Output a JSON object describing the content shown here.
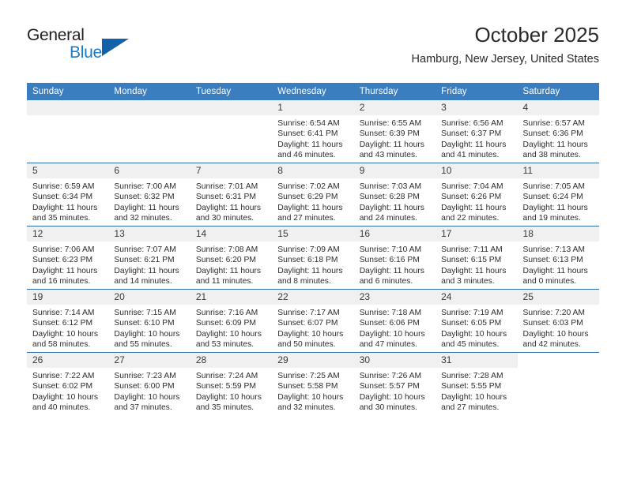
{
  "brand": {
    "word_one": "General",
    "word_two": "Blue",
    "triangle_color": "#1361a8",
    "blue_color": "#1b7bc4"
  },
  "header": {
    "title": "October 2025",
    "location": "Hamburg, New Jersey, United States"
  },
  "theme": {
    "header_bg": "#3a7ebf",
    "row_rule": "#2f6ea5",
    "daynum_bg": "#f0f0f0",
    "text": "#2d2d2d"
  },
  "weekday_headers": [
    "Sunday",
    "Monday",
    "Tuesday",
    "Wednesday",
    "Thursday",
    "Friday",
    "Saturday"
  ],
  "weeks": [
    [
      {
        "day": "",
        "sunrise": "",
        "sunset": "",
        "daylight_a": "",
        "daylight_b": "",
        "state": "empty"
      },
      {
        "day": "",
        "sunrise": "",
        "sunset": "",
        "daylight_a": "",
        "daylight_b": "",
        "state": "empty"
      },
      {
        "day": "",
        "sunrise": "",
        "sunset": "",
        "daylight_a": "",
        "daylight_b": "",
        "state": "empty"
      },
      {
        "day": "1",
        "sunrise": "Sunrise: 6:54 AM",
        "sunset": "Sunset: 6:41 PM",
        "daylight_a": "Daylight: 11 hours",
        "daylight_b": "and 46 minutes.",
        "state": "day"
      },
      {
        "day": "2",
        "sunrise": "Sunrise: 6:55 AM",
        "sunset": "Sunset: 6:39 PM",
        "daylight_a": "Daylight: 11 hours",
        "daylight_b": "and 43 minutes.",
        "state": "day"
      },
      {
        "day": "3",
        "sunrise": "Sunrise: 6:56 AM",
        "sunset": "Sunset: 6:37 PM",
        "daylight_a": "Daylight: 11 hours",
        "daylight_b": "and 41 minutes.",
        "state": "day"
      },
      {
        "day": "4",
        "sunrise": "Sunrise: 6:57 AM",
        "sunset": "Sunset: 6:36 PM",
        "daylight_a": "Daylight: 11 hours",
        "daylight_b": "and 38 minutes.",
        "state": "day"
      }
    ],
    [
      {
        "day": "5",
        "sunrise": "Sunrise: 6:59 AM",
        "sunset": "Sunset: 6:34 PM",
        "daylight_a": "Daylight: 11 hours",
        "daylight_b": "and 35 minutes.",
        "state": "day"
      },
      {
        "day": "6",
        "sunrise": "Sunrise: 7:00 AM",
        "sunset": "Sunset: 6:32 PM",
        "daylight_a": "Daylight: 11 hours",
        "daylight_b": "and 32 minutes.",
        "state": "day"
      },
      {
        "day": "7",
        "sunrise": "Sunrise: 7:01 AM",
        "sunset": "Sunset: 6:31 PM",
        "daylight_a": "Daylight: 11 hours",
        "daylight_b": "and 30 minutes.",
        "state": "day"
      },
      {
        "day": "8",
        "sunrise": "Sunrise: 7:02 AM",
        "sunset": "Sunset: 6:29 PM",
        "daylight_a": "Daylight: 11 hours",
        "daylight_b": "and 27 minutes.",
        "state": "day"
      },
      {
        "day": "9",
        "sunrise": "Sunrise: 7:03 AM",
        "sunset": "Sunset: 6:28 PM",
        "daylight_a": "Daylight: 11 hours",
        "daylight_b": "and 24 minutes.",
        "state": "day"
      },
      {
        "day": "10",
        "sunrise": "Sunrise: 7:04 AM",
        "sunset": "Sunset: 6:26 PM",
        "daylight_a": "Daylight: 11 hours",
        "daylight_b": "and 22 minutes.",
        "state": "day"
      },
      {
        "day": "11",
        "sunrise": "Sunrise: 7:05 AM",
        "sunset": "Sunset: 6:24 PM",
        "daylight_a": "Daylight: 11 hours",
        "daylight_b": "and 19 minutes.",
        "state": "day"
      }
    ],
    [
      {
        "day": "12",
        "sunrise": "Sunrise: 7:06 AM",
        "sunset": "Sunset: 6:23 PM",
        "daylight_a": "Daylight: 11 hours",
        "daylight_b": "and 16 minutes.",
        "state": "day"
      },
      {
        "day": "13",
        "sunrise": "Sunrise: 7:07 AM",
        "sunset": "Sunset: 6:21 PM",
        "daylight_a": "Daylight: 11 hours",
        "daylight_b": "and 14 minutes.",
        "state": "day"
      },
      {
        "day": "14",
        "sunrise": "Sunrise: 7:08 AM",
        "sunset": "Sunset: 6:20 PM",
        "daylight_a": "Daylight: 11 hours",
        "daylight_b": "and 11 minutes.",
        "state": "day"
      },
      {
        "day": "15",
        "sunrise": "Sunrise: 7:09 AM",
        "sunset": "Sunset: 6:18 PM",
        "daylight_a": "Daylight: 11 hours",
        "daylight_b": "and 8 minutes.",
        "state": "day"
      },
      {
        "day": "16",
        "sunrise": "Sunrise: 7:10 AM",
        "sunset": "Sunset: 6:16 PM",
        "daylight_a": "Daylight: 11 hours",
        "daylight_b": "and 6 minutes.",
        "state": "day"
      },
      {
        "day": "17",
        "sunrise": "Sunrise: 7:11 AM",
        "sunset": "Sunset: 6:15 PM",
        "daylight_a": "Daylight: 11 hours",
        "daylight_b": "and 3 minutes.",
        "state": "day"
      },
      {
        "day": "18",
        "sunrise": "Sunrise: 7:13 AM",
        "sunset": "Sunset: 6:13 PM",
        "daylight_a": "Daylight: 11 hours",
        "daylight_b": "and 0 minutes.",
        "state": "day"
      }
    ],
    [
      {
        "day": "19",
        "sunrise": "Sunrise: 7:14 AM",
        "sunset": "Sunset: 6:12 PM",
        "daylight_a": "Daylight: 10 hours",
        "daylight_b": "and 58 minutes.",
        "state": "day"
      },
      {
        "day": "20",
        "sunrise": "Sunrise: 7:15 AM",
        "sunset": "Sunset: 6:10 PM",
        "daylight_a": "Daylight: 10 hours",
        "daylight_b": "and 55 minutes.",
        "state": "day"
      },
      {
        "day": "21",
        "sunrise": "Sunrise: 7:16 AM",
        "sunset": "Sunset: 6:09 PM",
        "daylight_a": "Daylight: 10 hours",
        "daylight_b": "and 53 minutes.",
        "state": "day"
      },
      {
        "day": "22",
        "sunrise": "Sunrise: 7:17 AM",
        "sunset": "Sunset: 6:07 PM",
        "daylight_a": "Daylight: 10 hours",
        "daylight_b": "and 50 minutes.",
        "state": "day"
      },
      {
        "day": "23",
        "sunrise": "Sunrise: 7:18 AM",
        "sunset": "Sunset: 6:06 PM",
        "daylight_a": "Daylight: 10 hours",
        "daylight_b": "and 47 minutes.",
        "state": "day"
      },
      {
        "day": "24",
        "sunrise": "Sunrise: 7:19 AM",
        "sunset": "Sunset: 6:05 PM",
        "daylight_a": "Daylight: 10 hours",
        "daylight_b": "and 45 minutes.",
        "state": "day"
      },
      {
        "day": "25",
        "sunrise": "Sunrise: 7:20 AM",
        "sunset": "Sunset: 6:03 PM",
        "daylight_a": "Daylight: 10 hours",
        "daylight_b": "and 42 minutes.",
        "state": "day"
      }
    ],
    [
      {
        "day": "26",
        "sunrise": "Sunrise: 7:22 AM",
        "sunset": "Sunset: 6:02 PM",
        "daylight_a": "Daylight: 10 hours",
        "daylight_b": "and 40 minutes.",
        "state": "day"
      },
      {
        "day": "27",
        "sunrise": "Sunrise: 7:23 AM",
        "sunset": "Sunset: 6:00 PM",
        "daylight_a": "Daylight: 10 hours",
        "daylight_b": "and 37 minutes.",
        "state": "day"
      },
      {
        "day": "28",
        "sunrise": "Sunrise: 7:24 AM",
        "sunset": "Sunset: 5:59 PM",
        "daylight_a": "Daylight: 10 hours",
        "daylight_b": "and 35 minutes.",
        "state": "day"
      },
      {
        "day": "29",
        "sunrise": "Sunrise: 7:25 AM",
        "sunset": "Sunset: 5:58 PM",
        "daylight_a": "Daylight: 10 hours",
        "daylight_b": "and 32 minutes.",
        "state": "day"
      },
      {
        "day": "30",
        "sunrise": "Sunrise: 7:26 AM",
        "sunset": "Sunset: 5:57 PM",
        "daylight_a": "Daylight: 10 hours",
        "daylight_b": "and 30 minutes.",
        "state": "day"
      },
      {
        "day": "31",
        "sunrise": "Sunrise: 7:28 AM",
        "sunset": "Sunset: 5:55 PM",
        "daylight_a": "Daylight: 10 hours",
        "daylight_b": "and 27 minutes.",
        "state": "day"
      },
      {
        "day": "",
        "sunrise": "",
        "sunset": "",
        "daylight_a": "",
        "daylight_b": "",
        "state": "blank"
      }
    ]
  ]
}
